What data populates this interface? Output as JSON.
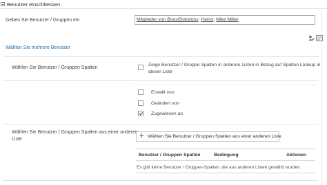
{
  "section": {
    "title": "Benutzer einschliessen"
  },
  "users_field": {
    "label": "Geben Sie Benutzer / Gruppen ein",
    "entries": [
      "Mitglieder von BoostSolutions",
      "Henry",
      "Mike Miller"
    ],
    "separator": "; "
  },
  "multi_users_link": "Wählen Sie mehrere Benutzer",
  "columns_section": {
    "label": "Wählen Sie Benutzer / Gruppen Spalten",
    "lookup_option": {
      "line1": "Zeige Benutzer / Gruppe Spalten in anderen Listen in Bezug auf Spalten Lookup in",
      "line2": "dieser Liste",
      "checked": false
    },
    "columns": [
      {
        "label": "Erstellt von",
        "checked": false
      },
      {
        "label": "Geändert von",
        "checked": false
      },
      {
        "label": "Zugewiesen an",
        "checked": true
      }
    ]
  },
  "other_list_section": {
    "label_line1": "Wählen Sie Benutzer / Gruppen Spalten aus einer anderen",
    "label_line2": "Liste",
    "add_button": "Wählen Sie Benutzer / Gruppen Spalten aus einer anderen Liste",
    "table_headers": [
      "Benutzer / Gruppen Spalten",
      "Bedingung",
      "Aktionen"
    ],
    "empty_message": "Es gibt keine Benutzer / Gruppen-Spalten, die aus anderen Listen gewählt wurden."
  },
  "icons": {
    "toggle": "minus-box-icon",
    "check_names": "check-names-icon",
    "browse": "address-book-icon",
    "add": "plus-icon"
  },
  "colors": {
    "link": "#1f6fb2",
    "add_icon": "#3aa43a",
    "border": "#e1e1e1"
  }
}
